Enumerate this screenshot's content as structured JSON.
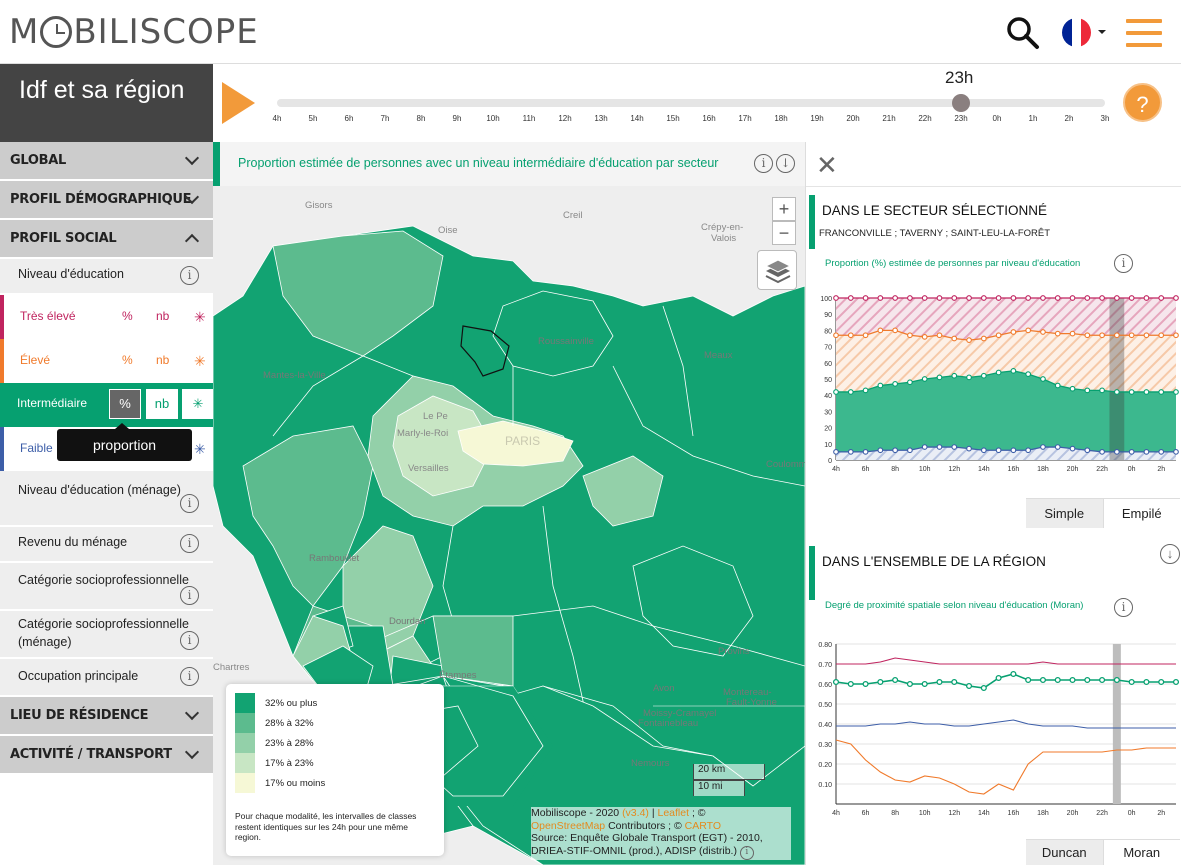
{
  "header": {
    "logo_left": "M",
    "logo_right": "BILISCOPE",
    "flag_colors": [
      "#002395",
      "#ffffff",
      "#ed2939"
    ]
  },
  "region": {
    "title": "Idf et sa région"
  },
  "timebar": {
    "current_time": "23h",
    "current_index": 19,
    "ticks": [
      "4h",
      "5h",
      "6h",
      "7h",
      "8h",
      "9h",
      "10h",
      "11h",
      "12h",
      "13h",
      "14h",
      "15h",
      "16h",
      "17h",
      "18h",
      "19h",
      "20h",
      "21h",
      "22h",
      "23h",
      "0h",
      "1h",
      "2h",
      "3h"
    ],
    "help_label": "?"
  },
  "sidebar": {
    "global": "GLOBAL",
    "demographic": "PROFIL DÉMOGRAPHIQUE",
    "social": "PROFIL SOCIAL",
    "education": "Niveau d'éducation",
    "modalities": {
      "tres_eleve": "Très élevé",
      "eleve": "Élevé",
      "intermediaire": "Intermédiaire",
      "faible": "Faible",
      "pct": "%",
      "nb": "nb",
      "star": "✳"
    },
    "tooltip": "proportion",
    "items": [
      "Niveau d'éducation (ménage)",
      "Revenu du ménage",
      "Catégorie socioprofessionnelle",
      "Catégorie socioprofessionnelle (ménage)",
      "Occupation principale"
    ],
    "residence": "LIEU DE RÉSIDENCE",
    "activity": "ACTIVITÉ / TRANSPORT",
    "info": "i",
    "colors": {
      "tres_eleve": "#c0245f",
      "eleve": "#f07a2b",
      "intermediaire": "#06a070",
      "faible": "#3d5ea8"
    }
  },
  "map": {
    "title": "Proportion estimée de personnes avec un niveau intermédiaire d'éducation par secteur",
    "info": "i",
    "download": "↓",
    "zoom_in": "+",
    "zoom_out": "−",
    "places": [
      "Gisors",
      "Creil",
      "Crépy-en-",
      "Valois",
      "Oise",
      "Roussainville",
      "Meaux",
      "Mantes-la-Ville",
      "Le Pe",
      "Marly-le-Roi",
      "PARIS",
      "Versailles",
      "Coulomm",
      "Rambouillet",
      "Dourdan",
      "Étampes",
      "Chartres",
      "Avon",
      "Moissy-Cramayel",
      "Fontainebleau",
      "Nemours",
      "Provins",
      "Montereau-",
      "Fault-Yonne"
    ],
    "legend": [
      {
        "label": "32% ou plus",
        "color": "#12a372"
      },
      {
        "label": "28% à 32%",
        "color": "#5cbb8e"
      },
      {
        "label": "23% à 28%",
        "color": "#93d0a9"
      },
      {
        "label": "17% à 23%",
        "color": "#c8e6c4"
      },
      {
        "label": "17% ou moins",
        "color": "#f6f8d6"
      }
    ],
    "legend_note": "Pour chaque modalité, les intervalles de classes restent identiques sur les 24h pour une même region.",
    "scale_km": "20 km",
    "scale_mi": "10 mi",
    "attribution": {
      "line1": "Mobiliscope - 2020",
      "version": "(v3.4)",
      "sep": "|",
      "leaflet": "Leaflet",
      "copy": "; ©",
      "osm": "OpenStreetMap",
      "contrib": "Contributors ; ©",
      "carto": "CARTO",
      "source": "Source: Enquête Globale Transport (EGT) - 2010, DRIEA-STIF-OMNIL (prod.), ADISP (distrib.)"
    }
  },
  "panel": {
    "close": "✕",
    "sector_title": "DANS LE SECTEUR SÉLECTIONNÉ",
    "sector_name": "FRANCONVILLE ; TAVERNY ; SAINT-LEU-LA-FORÊT",
    "chart1_title": "Proportion (%) estimée de personnes par niveau d'éducation",
    "tabs1": [
      "Simple",
      "Empilé"
    ],
    "region_title": "DANS L'ENSEMBLE DE LA RÉGION",
    "chart2_title": "Degré de proximité spatiale selon niveau d'éducation (Moran)",
    "tabs2": [
      "Duncan",
      "Moran"
    ],
    "download": "↓",
    "info": "i"
  },
  "chart_data": [
    {
      "type": "area",
      "x": [
        "4h",
        "5h",
        "6h",
        "7h",
        "8h",
        "9h",
        "10h",
        "11h",
        "12h",
        "13h",
        "14h",
        "15h",
        "16h",
        "17h",
        "18h",
        "19h",
        "20h",
        "21h",
        "22h",
        "23h",
        "0h",
        "1h",
        "2h",
        "3h"
      ],
      "ylim": [
        0,
        100
      ],
      "yticks": [
        0,
        10,
        20,
        30,
        40,
        50,
        60,
        70,
        80,
        90,
        100
      ],
      "xticks": [
        "4h",
        "6h",
        "8h",
        "10h",
        "12h",
        "14h",
        "16h",
        "18h",
        "20h",
        "22h",
        "0h",
        "2h"
      ],
      "highlight": "23h",
      "series": [
        {
          "values": [
            100,
            100,
            100,
            100,
            100,
            100,
            100,
            100,
            100,
            100,
            100,
            100,
            100,
            100,
            100,
            100,
            100,
            100,
            100,
            100,
            100,
            100,
            100,
            100
          ],
          "color": "#c0245f"
        },
        {
          "values": [
            77,
            77,
            77,
            80,
            80,
            77,
            76,
            77,
            75,
            74,
            75,
            77,
            79,
            80,
            79,
            78,
            78,
            77,
            77,
            77,
            77,
            77,
            77,
            77
          ],
          "color": "#f07a2b"
        },
        {
          "values": [
            42,
            42,
            43,
            46,
            47,
            48,
            50,
            51,
            52,
            51,
            52,
            54,
            55,
            53,
            50,
            46,
            44,
            43,
            43,
            42,
            42,
            42,
            42,
            42
          ],
          "color": "#06a070"
        },
        {
          "values": [
            5,
            5,
            5,
            6,
            6,
            6,
            8,
            8,
            8,
            7,
            6,
            6,
            6,
            6,
            8,
            8,
            7,
            6,
            5,
            5,
            5,
            5,
            5,
            5
          ],
          "color": "#3d5ea8"
        }
      ]
    },
    {
      "type": "line",
      "x": [
        "4h",
        "5h",
        "6h",
        "7h",
        "8h",
        "9h",
        "10h",
        "11h",
        "12h",
        "13h",
        "14h",
        "15h",
        "16h",
        "17h",
        "18h",
        "19h",
        "20h",
        "21h",
        "22h",
        "23h",
        "0h",
        "1h",
        "2h",
        "3h"
      ],
      "ylim": [
        0.0,
        0.8
      ],
      "yticks": [
        "0.10",
        "0.20",
        "0.30",
        "0.40",
        "0.50",
        "0.60",
        "0.70",
        "0.80"
      ],
      "xticks": [
        "4h",
        "6h",
        "8h",
        "10h",
        "12h",
        "14h",
        "16h",
        "18h",
        "20h",
        "22h",
        "0h",
        "2h"
      ],
      "highlight": "23h",
      "series": [
        {
          "values": [
            0.7,
            0.7,
            0.7,
            0.71,
            0.73,
            0.72,
            0.71,
            0.7,
            0.7,
            0.7,
            0.7,
            0.7,
            0.7,
            0.7,
            0.71,
            0.7,
            0.7,
            0.7,
            0.7,
            0.7,
            0.7,
            0.7,
            0.7,
            0.7
          ],
          "color": "#c0245f"
        },
        {
          "values": [
            0.61,
            0.6,
            0.6,
            0.61,
            0.62,
            0.6,
            0.6,
            0.61,
            0.61,
            0.59,
            0.58,
            0.63,
            0.65,
            0.62,
            0.62,
            0.62,
            0.62,
            0.62,
            0.62,
            0.62,
            0.61,
            0.61,
            0.61,
            0.61
          ],
          "color": "#06a070"
        },
        {
          "values": [
            0.39,
            0.39,
            0.39,
            0.4,
            0.4,
            0.41,
            0.4,
            0.4,
            0.39,
            0.39,
            0.4,
            0.41,
            0.42,
            0.4,
            0.39,
            0.39,
            0.39,
            0.38,
            0.38,
            0.38,
            0.38,
            0.38,
            0.38,
            0.38
          ],
          "color": "#3d5ea8"
        },
        {
          "values": [
            0.32,
            0.3,
            0.22,
            0.16,
            0.12,
            0.11,
            0.14,
            0.13,
            0.1,
            0.06,
            0.05,
            0.1,
            0.07,
            0.2,
            0.26,
            0.26,
            0.26,
            0.26,
            0.26,
            0.27,
            0.27,
            0.28,
            0.28,
            0.28
          ],
          "color": "#f07a2b"
        }
      ]
    }
  ]
}
